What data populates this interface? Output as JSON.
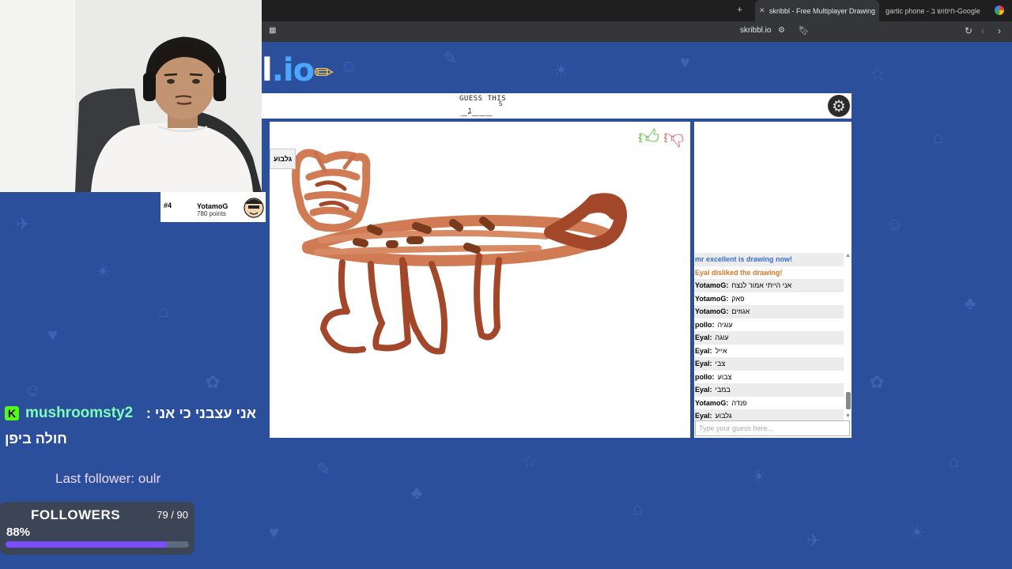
{
  "browser": {
    "tabs": [
      {
        "title": "skribbl - Free Multiplayer Drawing",
        "active": true
      },
      {
        "title": "gartic phone - חיפוש ב-Google",
        "active": false
      }
    ],
    "url": "skribbl.io"
  },
  "logo": {
    "prefix": "l",
    "suffix": ".io"
  },
  "game": {
    "guess_label": "GUESS THIS",
    "guess_count": "5",
    "word_hint": "_ג___",
    "word_tag": "גלבוע"
  },
  "player": {
    "rank": "#4",
    "name": "YotamoG",
    "points": "780 points"
  },
  "chat": {
    "messages": [
      {
        "type": "sys-blue",
        "name": "",
        "text": "mr excellent is drawing now!"
      },
      {
        "type": "sys-orange",
        "name": "",
        "text": "Eyal disliked the drawing!"
      },
      {
        "type": "msg",
        "name": "YotamoG:",
        "text": "אני הייתי אמור לנצח"
      },
      {
        "type": "msg",
        "name": "YotamoG:",
        "text": "פאק"
      },
      {
        "type": "msg",
        "name": "YotamoG:",
        "text": "אגוזים"
      },
      {
        "type": "msg",
        "name": "pollo:",
        "text": "עוגיה"
      },
      {
        "type": "msg",
        "name": "Eyal:",
        "text": "עוגה"
      },
      {
        "type": "msg",
        "name": "Eyal:",
        "text": "אייל"
      },
      {
        "type": "msg",
        "name": "Eyal:",
        "text": "צבי"
      },
      {
        "type": "msg",
        "name": "pollo:",
        "text": "צבוע"
      },
      {
        "type": "msg",
        "name": "Eyal:",
        "text": "במבי"
      },
      {
        "type": "msg",
        "name": "YotamoG:",
        "text": "פנדה"
      },
      {
        "type": "msg",
        "name": "Eyal:",
        "text": "גלבוע"
      }
    ],
    "input_placeholder": "Type your guess here..."
  },
  "overlay": {
    "badge": "K",
    "chat_user": "mushroomsty2",
    "chat_line1": "אני עצבני כי אני :",
    "chat_line2": "חולה ביפן",
    "last_follower": "Last follower: oulr",
    "followers_title": "FOLLOWERS",
    "followers_count": "79 / 90",
    "followers_percent": "88%",
    "followers_progress": 0.88
  },
  "colors": {
    "page_bg": "#2c4f9c",
    "drawing_light": "#d07b54",
    "drawing_dark": "#a3472a",
    "drawing_spots": "#7a3a1c",
    "progress_fill": "#7b4dff"
  },
  "icons": [
    "close-icon",
    "plus-icon",
    "google-icon",
    "reload-icon",
    "back-icon",
    "forward-icon",
    "bookmark-icon",
    "settings-gear-icon",
    "thumbs-up-icon",
    "thumbs-down-icon"
  ]
}
